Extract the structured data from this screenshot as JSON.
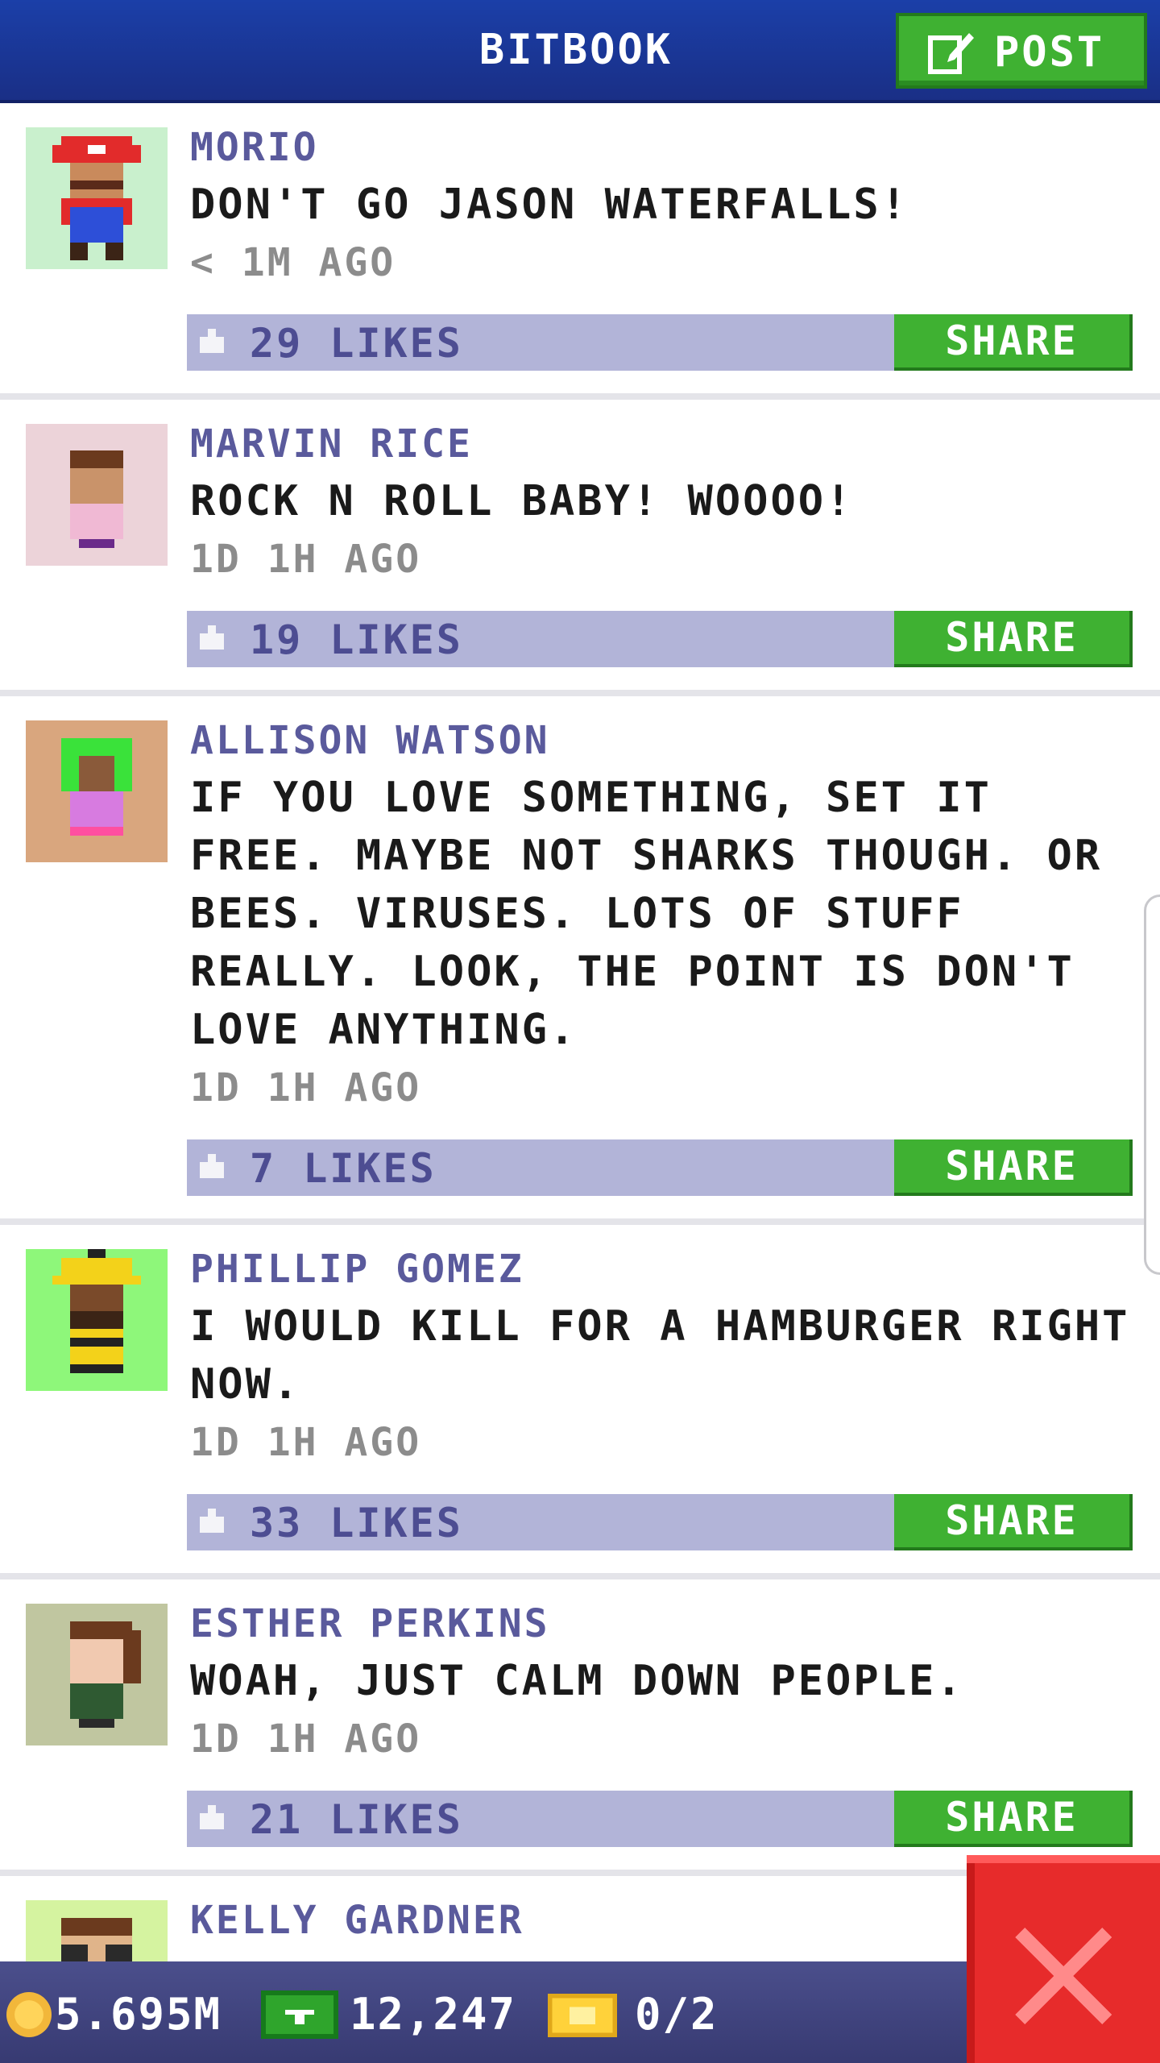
{
  "app": {
    "title": "BITBOOK",
    "post_label": "POST"
  },
  "posts": [
    {
      "author": "MORIO",
      "message": "DON'T GO JASON WATERFALLS!",
      "time": "< 1M AGO",
      "likes": "29 LIKES",
      "share": "SHARE",
      "avatar_bg": "#c9f0cd"
    },
    {
      "author": "MARVIN RICE",
      "message": "ROCK N ROLL BABY! WOOOO!",
      "time": "1D 1H AGO",
      "likes": "19 LIKES",
      "share": "SHARE",
      "avatar_bg": "#ecd3d9"
    },
    {
      "author": "ALLISON WATSON",
      "message": "IF YOU LOVE SOMETHING, SET IT FREE. MAYBE NOT SHARKS THOUGH. OR BEES. VIRUSES. LOTS OF STUFF REALLY. LOOK, THE POINT IS DON'T LOVE ANYTHING.",
      "time": "1D 1H AGO",
      "likes": "7 LIKES",
      "share": "SHARE",
      "avatar_bg": "#d9a67e"
    },
    {
      "author": "PHILLIP GOMEZ",
      "message": "I WOULD KILL FOR A HAMBURGER RIGHT NOW.",
      "time": "1D 1H AGO",
      "likes": "33 LIKES",
      "share": "SHARE",
      "avatar_bg": "#8ef77a"
    },
    {
      "author": "ESTHER PERKINS",
      "message": "WOAH, JUST CALM DOWN PEOPLE.",
      "time": "1D 1H AGO",
      "likes": "21 LIKES",
      "share": "SHARE",
      "avatar_bg": "#c0c6a0"
    },
    {
      "author": "KELLY GARDNER",
      "message": "",
      "time": "",
      "likes": "",
      "share": "",
      "avatar_bg": "#d5f3a0"
    }
  ],
  "status": {
    "coins": "5.695M",
    "bux": "12,247",
    "tickets": "0/2"
  },
  "colors": {
    "header": "#1b3fa8",
    "accent_green": "#3fb132",
    "likes_bar": "#b2b4d8",
    "author_text": "#5a5a9c",
    "close_red": "#e72b2b"
  },
  "icons": [
    "edit-icon",
    "like-icon",
    "coin-icon",
    "bux-icon",
    "ticket-icon",
    "close-icon"
  ]
}
